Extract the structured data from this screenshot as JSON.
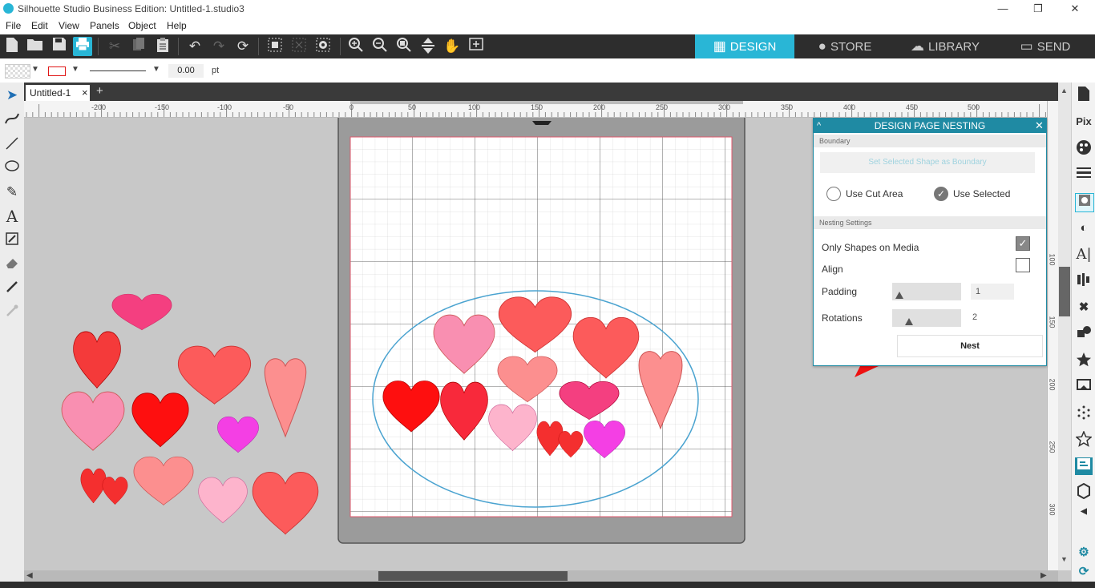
{
  "window": {
    "title": "Silhouette Studio Business Edition: Untitled-1.studio3",
    "minimize": "—",
    "restore": "❐",
    "close": "✕"
  },
  "menu": [
    "File",
    "Edit",
    "View",
    "Panels",
    "Object",
    "Help"
  ],
  "nav_tabs": [
    {
      "label": "DESIGN",
      "icon": "grid-icon",
      "active": true
    },
    {
      "label": "STORE",
      "icon": "store-icon",
      "active": false
    },
    {
      "label": "LIBRARY",
      "icon": "cloud-icon",
      "active": false
    },
    {
      "label": "SEND",
      "icon": "cutter-icon",
      "active": false
    }
  ],
  "line_options": {
    "line_width": "0.00",
    "unit": "pt"
  },
  "document_tab": {
    "name": "Untitled-1",
    "close": "×",
    "add": "+"
  },
  "hruler_labels": [
    "-200",
    "-150",
    "-100",
    "-50",
    "0",
    "50",
    "100",
    "150",
    "200",
    "250",
    "300",
    "350",
    "400",
    "450",
    "500"
  ],
  "vruler_labels": [
    "100",
    "150",
    "200",
    "250",
    "300"
  ],
  "nesting_panel": {
    "title": "DESIGN PAGE NESTING",
    "boundary_header": "Boundary",
    "set_boundary_button": "Set Selected Shape as Boundary",
    "use_cut_area": "Use Cut Area",
    "use_selected": "Use Selected",
    "nesting_header": "Nesting Settings",
    "only_shapes_label": "Only Shapes on Media",
    "only_shapes_checked": true,
    "align_label": "Align",
    "align_checked": false,
    "padding_label": "Padding",
    "padding_value": "1",
    "padding_level": 0.05,
    "rotations_label": "Rotations",
    "rotations_value": "2",
    "rotations_level": 0.2,
    "nest_button": "Nest"
  },
  "colors": {
    "accent": "#29b6d6",
    "panel_header": "#1f8aa3",
    "toolbar": "#2d2d2d",
    "red_arrow": "#ee1111",
    "boundary_ellipse": "#4aa3d0"
  }
}
